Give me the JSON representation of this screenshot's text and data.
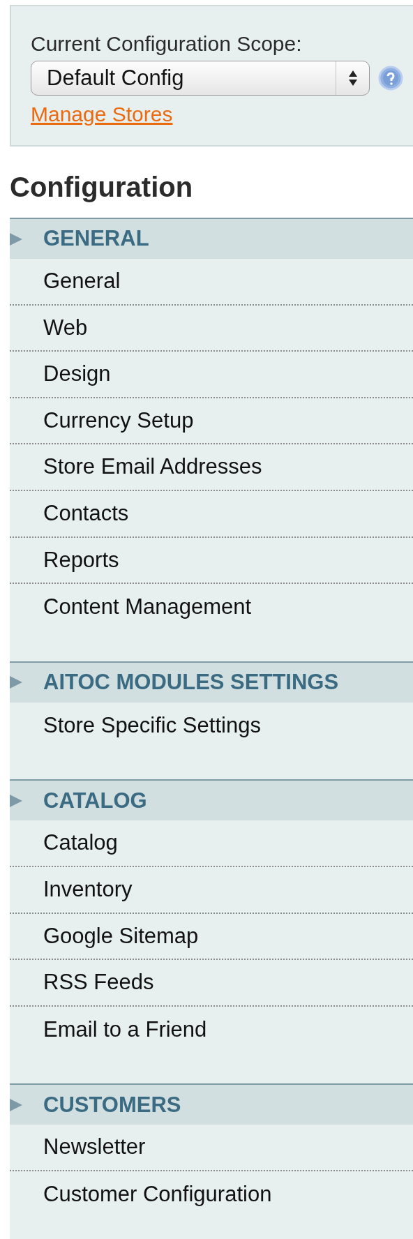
{
  "scope": {
    "label": "Current Configuration Scope:",
    "value": "Default Config",
    "link": "Manage Stores"
  },
  "title": "Configuration",
  "sections": [
    {
      "title": "GENERAL",
      "items": [
        "General",
        "Web",
        "Design",
        "Currency Setup",
        "Store Email Addresses",
        "Contacts",
        "Reports",
        "Content Management"
      ]
    },
    {
      "title": "AITOC MODULES SETTINGS",
      "items": [
        "Store Specific Settings"
      ]
    },
    {
      "title": "CATALOG",
      "items": [
        "Catalog",
        "Inventory",
        "Google Sitemap",
        "RSS Feeds",
        "Email to a Friend"
      ]
    },
    {
      "title": "CUSTOMERS",
      "items": [
        "Newsletter",
        "Customer Configuration"
      ]
    }
  ]
}
